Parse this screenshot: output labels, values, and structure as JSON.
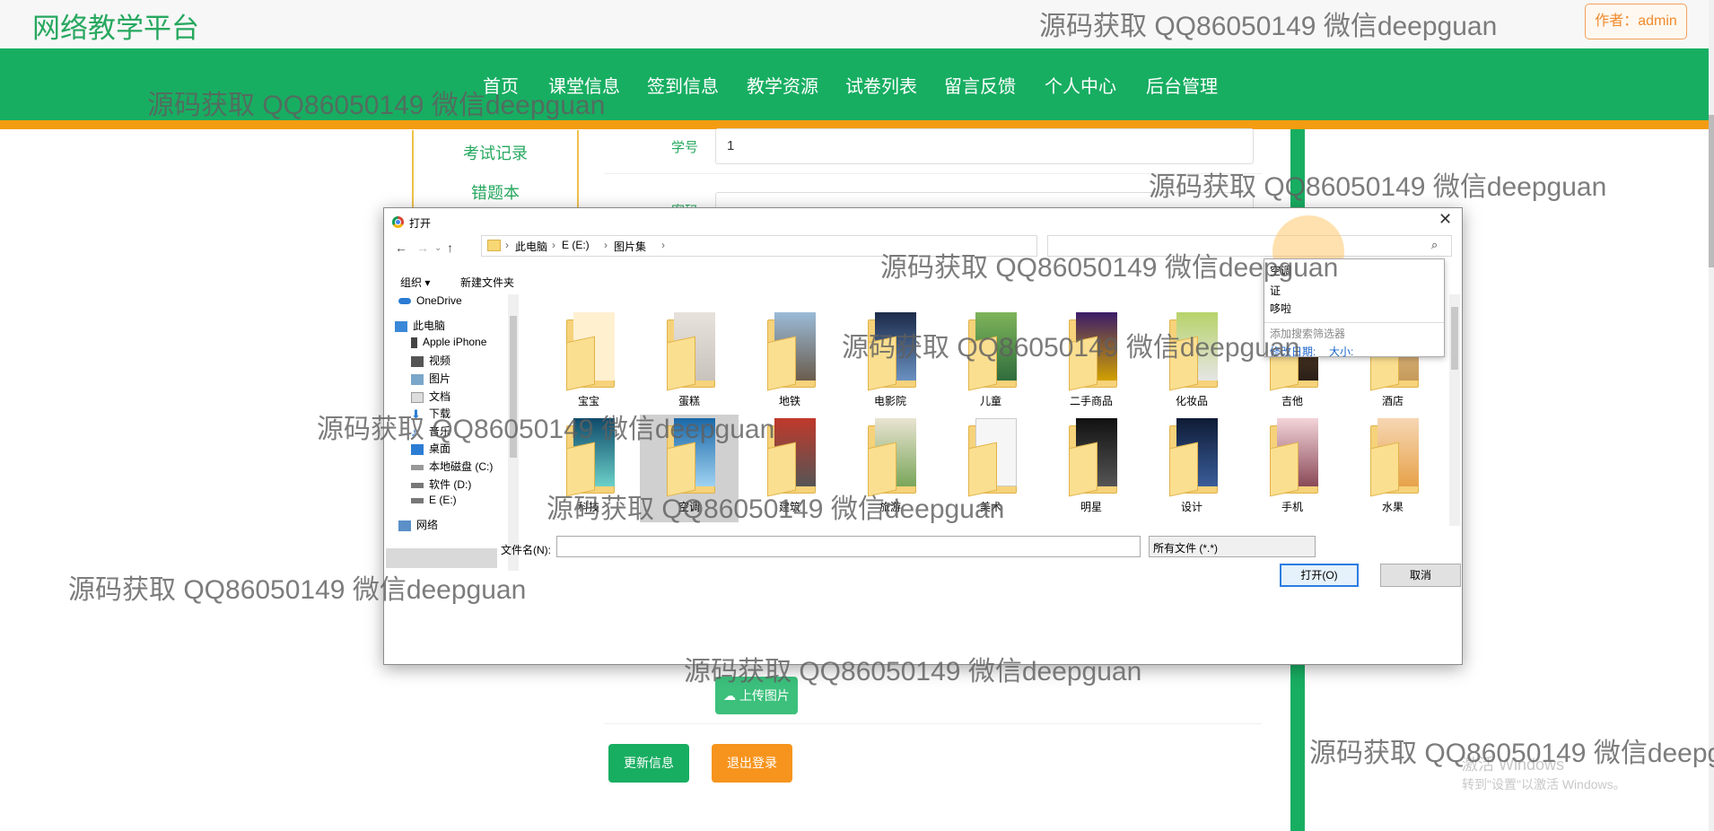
{
  "site": {
    "title": "网络教学平台",
    "author": "作者：admin"
  },
  "nav": [
    "首页",
    "课堂信息",
    "签到信息",
    "教学资源",
    "试卷列表",
    "留言反馈",
    "个人中心",
    "后台管理"
  ],
  "left_menu": [
    "考试记录",
    "错题本"
  ],
  "form": {
    "student_id_label": "学号",
    "student_id_value": "1",
    "password_label": "密码",
    "upload_label": "上传图片",
    "update_label": "更新信息",
    "logout_label": "退出登录"
  },
  "dialog": {
    "title": "打开",
    "breadcrumb": [
      "此电脑",
      "E (E:)",
      "图片集"
    ],
    "organize": "组织 ▾",
    "new_folder": "新建文件夹",
    "sidebar": [
      "OneDrive",
      "此电脑",
      "Apple iPhone",
      "视频",
      "图片",
      "文档",
      "下载",
      "音乐",
      "桌面",
      "本地磁盘 (C:)",
      "软件 (D:)",
      "E (E:)",
      "网络"
    ],
    "folders_row1": [
      "宝宝",
      "蛋糕",
      "地铁",
      "电影院",
      "儿童",
      "二手商品",
      "化妆品",
      "吉他",
      "酒店"
    ],
    "folders_row2": [
      "科技",
      "空调",
      "建筑",
      "旅游",
      "美术",
      "明星",
      "设计",
      "手机",
      "水果"
    ],
    "filename_label": "文件名(N):",
    "filename_value": "",
    "filetype": "所有文件 (*.*)",
    "open_button": "打开(O)",
    "cancel_button": "取消",
    "search_suggestions": [
      "空调",
      "证",
      "哆啦"
    ],
    "search_filter_label": "添加搜索筛选器",
    "search_filter_links": [
      "修改日期:",
      "大小:"
    ]
  },
  "windows_activation": {
    "line1": "激活 Windows",
    "line2": "转到\"设置\"以激活 Windows。"
  },
  "watermark": "源码获取 QQ86050149 微信deepguan",
  "colors": {
    "primary": "#18ae62",
    "accent": "#f39c12",
    "logout": "#f7941d"
  }
}
